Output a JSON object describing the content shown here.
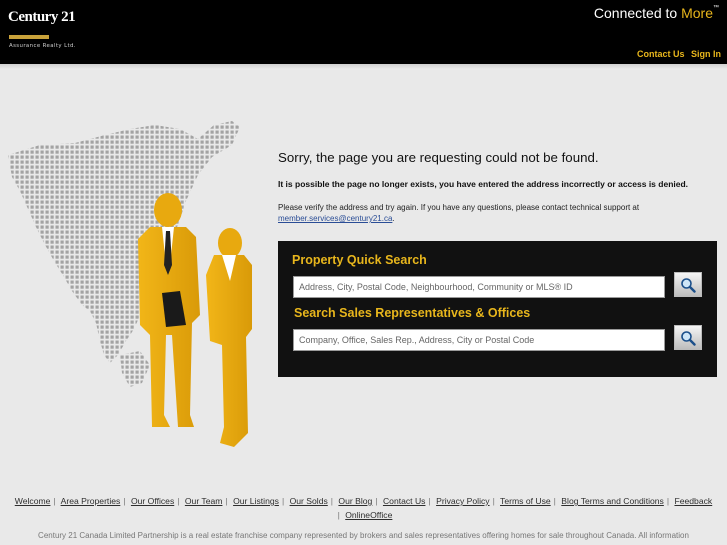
{
  "brand": {
    "logo_word": "Century 21",
    "logo_sub": "Assurance Realty Ltd.",
    "tagline_prefix": "Connected to",
    "tagline_accent": "More",
    "tagline_tm": "™",
    "colors": {
      "gold": "#e8b61c",
      "header": "#000000",
      "panel": "#111111",
      "page": "#e9e9e9"
    }
  },
  "header_links": [
    {
      "label": "Contact Us"
    },
    {
      "label": "Sign In"
    }
  ],
  "error": {
    "title": "Sorry, the page you are requesting could not be found.",
    "detail": "It is possible the page no longer exists, you have entered the address incorrectly or access is denied.",
    "note": "Please verify the address and try again. If you have any questions, please contact technical support at",
    "email": "member.services@century21.ca",
    "note_end": "."
  },
  "search": {
    "property": {
      "heading": "Property Quick Search",
      "placeholder": "Address, City, Postal Code, Neighbourhood, Community or MLS® ID",
      "button_icon": "magnifier-icon"
    },
    "reps": {
      "heading": "Search Sales Representatives & Offices",
      "placeholder": "Company, Office, Sales Rep., Address, City or Postal Code",
      "button_icon": "magnifier-icon"
    }
  },
  "footer": {
    "links": [
      "Welcome",
      "Area Properties",
      "Our Offices",
      "Our Team",
      "Our Listings",
      "Our Solds",
      "Our Blog",
      "Contact Us",
      "Privacy Policy",
      "Terms of Use",
      "Blog Terms and Conditions",
      "Feedback",
      "OnlineOffice"
    ],
    "separator": "|",
    "legal": "Century 21 Canada Limited Partnership is a real estate franchise company represented by brokers and sales representatives offering homes for sale throughout Canada. All information"
  },
  "illustration": {
    "icon": "business-people-map-illustration"
  }
}
